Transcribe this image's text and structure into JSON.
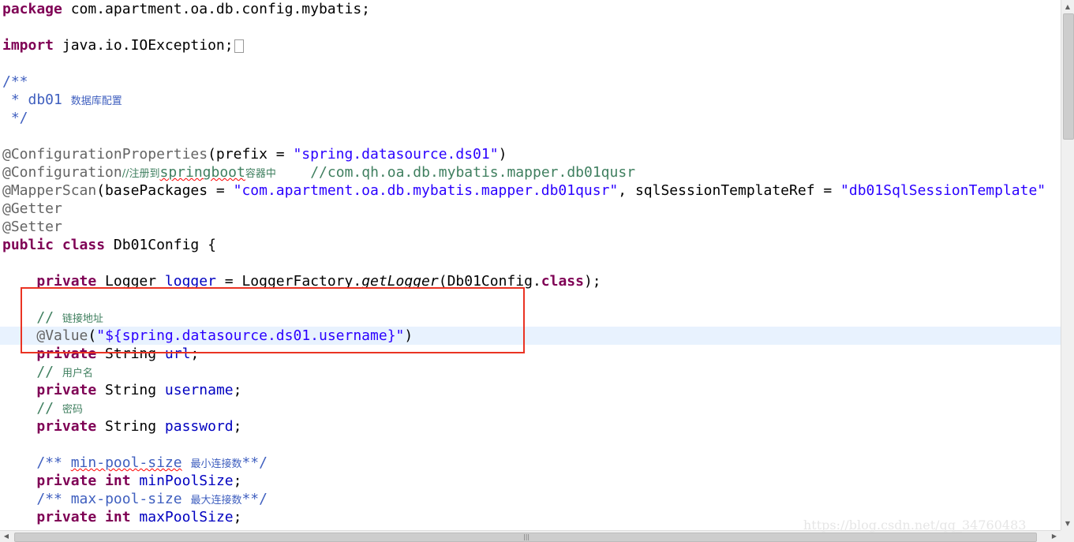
{
  "watermark": "https://blog.csdn.net/qq_34760483",
  "colors": {
    "keyword": "#7f0055",
    "annotation": "#646464",
    "string": "#2a00ff",
    "comment": "#3f7f5f",
    "javadoc": "#3f5fbf",
    "field": "#0000c0",
    "current_line": "#e8f2fe",
    "highlight_box": "#ea3323"
  },
  "icons": {
    "fold_marker": "collapsed-import-icon",
    "scroll_up": "scroll-up-arrow-icon",
    "scroll_down": "scroll-down-arrow-icon",
    "scroll_left": "scroll-left-arrow-icon",
    "scroll_right": "scroll-right-arrow-icon"
  },
  "code": {
    "l1": {
      "kw": "package",
      "rest": " com.apartment.oa.db.config.mybatis;"
    },
    "l2": {
      "kw": "import",
      "rest": " java.io.IOException;"
    },
    "l3": {
      "jd_open": "/**"
    },
    "l4": {
      "prefix": " * db01 ",
      "text": "数据库配置"
    },
    "l5": {
      "jd_close": " */"
    },
    "l6": {
      "ann": "@ConfigurationProperties",
      "pre": "(prefix = ",
      "str": "\"spring.datasource.ds01\"",
      "post": ")"
    },
    "l7": {
      "ann": "@Configuration",
      "cm1": "//注册到",
      "cm2": "springboot",
      "cm3": "容器中",
      "cm4": "    //com.qh.oa.db.mybatis.mapper.db01qusr"
    },
    "l8": {
      "ann": "@MapperScan",
      "pre": "(basePackages = ",
      "str1": "\"com.apartment.oa.db.mybatis.mapper.db01qusr\"",
      "mid": ", sqlSessionTemplateRef = ",
      "str2": "\"db01SqlSessionTemplate\""
    },
    "l9": {
      "ann": "@Getter"
    },
    "l10": {
      "ann": "@Setter"
    },
    "l11": {
      "kw1": "public",
      "kw2": "class",
      "rest": " Db01Config {"
    },
    "l12": {
      "kw": "private",
      "type": " Logger ",
      "fld": "logger",
      "eq": " = LoggerFactory.",
      "mth": "getLogger",
      "arg": "(Db01Config.",
      "kw2": "class",
      "end": ");"
    },
    "l13": {
      "cm": "// ",
      "text": "链接地址"
    },
    "l14": {
      "ann": "@Value",
      "pre": "(",
      "str": "\"${spring.datasource.ds01.username}\"",
      "post": ")"
    },
    "l15": {
      "kw": "private",
      "type": " String ",
      "fld": "url",
      "end": ";"
    },
    "l16": {
      "cm": "// ",
      "text": "用户名"
    },
    "l17": {
      "kw": "private",
      "type": " String ",
      "fld": "username",
      "end": ";"
    },
    "l18": {
      "cm": "// ",
      "text": "密码"
    },
    "l19": {
      "kw": "private",
      "type": " String ",
      "fld": "password",
      "end": ";"
    },
    "l20": {
      "jd1": "/** ",
      "jd2": "min-pool-size",
      "jd3": " ",
      "text": "最小连接数",
      "jd4": "**/"
    },
    "l21": {
      "kw1": "private",
      "kw2": "int",
      "fld": "minPoolSize",
      "end": ";"
    },
    "l22": {
      "jd1": "/** ",
      "jd2": "max-pool-size",
      "jd3": " ",
      "text": "最大连接数",
      "jd4": "**/"
    },
    "l23": {
      "kw1": "private",
      "kw2": "int",
      "fld": "maxPoolSize",
      "end": ";"
    }
  }
}
